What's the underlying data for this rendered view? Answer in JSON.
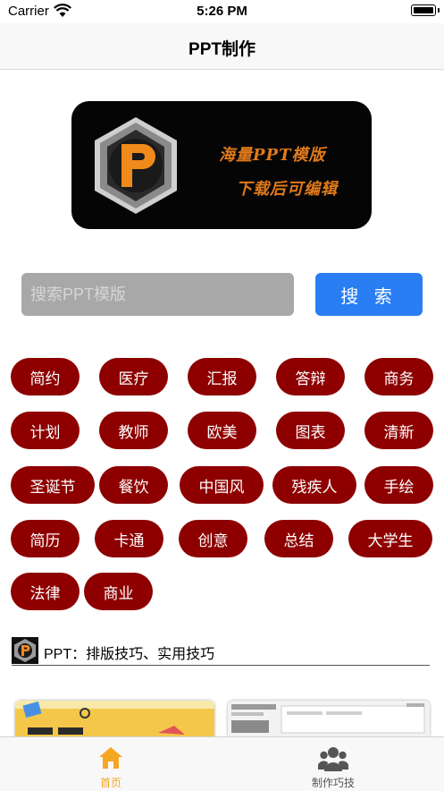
{
  "status_bar": {
    "carrier": "Carrier",
    "time": "5:26 PM"
  },
  "nav": {
    "title": "PPT制作"
  },
  "banner": {
    "line1": "海量PPT模版",
    "line2": "下载后可编辑"
  },
  "search": {
    "placeholder": "搜索PPT模版",
    "button_label": "搜 索"
  },
  "tags": [
    "简约",
    "医疗",
    "汇报",
    "答辩",
    "商务",
    "计划",
    "教师",
    "欧美",
    "图表",
    "清新",
    "圣诞节",
    "餐饮",
    "中国风",
    "残疾人",
    "手绘",
    "简历",
    "卡通",
    "创意",
    "总结",
    "大学生",
    "法律",
    "商业"
  ],
  "section": {
    "title": "PPT：排版技巧、实用技巧"
  },
  "tabbar": {
    "tabs": [
      {
        "label": "首页",
        "icon": "home-icon",
        "active": true
      },
      {
        "label": "制作巧技",
        "icon": "group-icon",
        "active": false
      }
    ],
    "active_color": "#f5a623",
    "inactive_color": "#555555"
  },
  "colors": {
    "tag_bg": "#8e0000",
    "search_button": "#2a7ef4",
    "banner_text": "#e07a1a"
  }
}
